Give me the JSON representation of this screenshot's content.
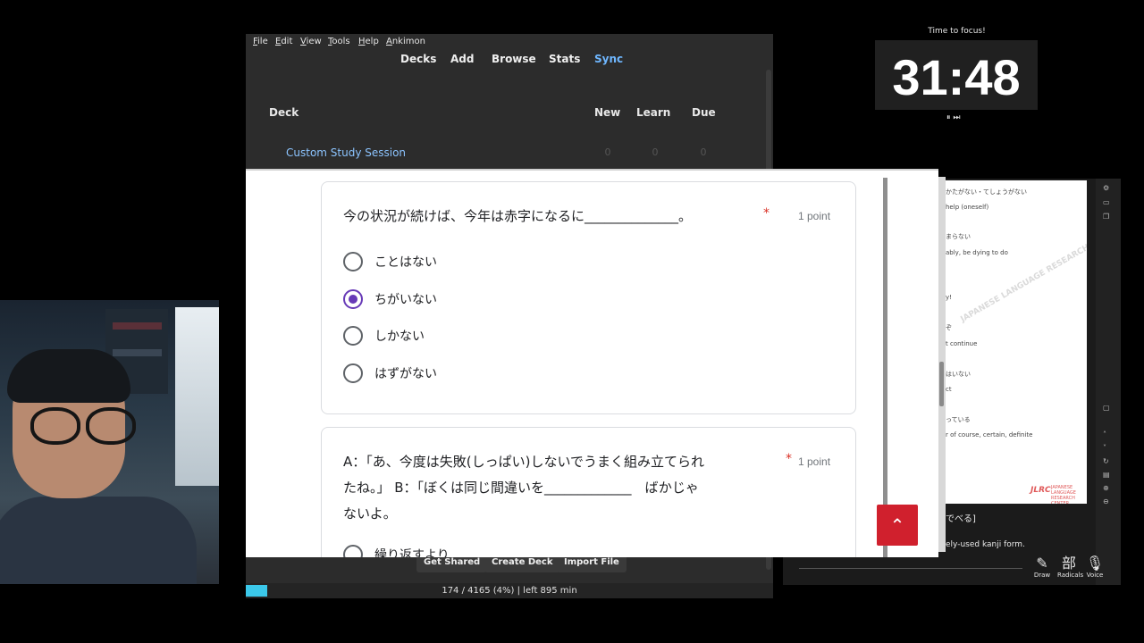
{
  "anki": {
    "menu": [
      {
        "label": "File",
        "u": "F"
      },
      {
        "label": "Edit",
        "u": "E"
      },
      {
        "label": "View",
        "u": "V"
      },
      {
        "label": "Tools",
        "u": "T"
      },
      {
        "label": "Help",
        "u": "H"
      },
      {
        "label": "Ankimon",
        "u": "A"
      }
    ],
    "tabs": [
      "Decks",
      "Add",
      "Browse",
      "Stats",
      "Sync"
    ],
    "columns": {
      "deck": "Deck",
      "new": "New",
      "learn": "Learn",
      "due": "Due"
    },
    "rows": [
      {
        "name": "Custom Study Session",
        "new": "0",
        "learn": "0",
        "due": "0"
      }
    ],
    "bottom_buttons": [
      "Get Shared",
      "Create Deck",
      "Import File"
    ],
    "status": "174 / 4165 (4%) | left 895 min"
  },
  "timer": {
    "label": "Time to focus!",
    "time": "31:48",
    "controls": "⏸ ⏭"
  },
  "dictionary": {
    "lines": [
      "かたがない・てしょうがない",
      "help (oneself)",
      "まらない",
      "ably, be dying to do",
      "y!",
      "ぞ",
      "t continue",
      "はいない",
      "ct",
      "っている",
      "r of course, certain, definite"
    ],
    "watermark": "JAPANESE LANGUAGE RESEARCH CENTER",
    "logo": "JLRC",
    "logo_sub": "JAPANESE LANGUAGE RESEARCH CENTER",
    "bottom_text_1": "でべる]",
    "bottom_text_2": "ely-used kanji form.",
    "tools": [
      {
        "icon": "✎",
        "label": "Draw"
      },
      {
        "icon": "部",
        "label": "Radicals"
      },
      {
        "icon": "🎙",
        "label": "Voice"
      }
    ]
  },
  "form": {
    "accent_color": "#673ab7",
    "required_color": "#d93025",
    "questions": [
      {
        "text": "今の状況が続けば、今年は赤字になるに______________。",
        "required": "*",
        "points": "1 point",
        "options": [
          {
            "label": "ことはない",
            "selected": false
          },
          {
            "label": "ちがいない",
            "selected": true
          },
          {
            "label": "しかない",
            "selected": false
          },
          {
            "label": "はずがない",
            "selected": false
          }
        ]
      },
      {
        "text_line1": "A：「あ、今度は失敗(しっぱい)しないでうまく組み立てられ",
        "text_line2": "たね。」 B：「ぼくは同じ間違いを_____________　ばかじゃ",
        "text_line3": "ないよ。",
        "required": "*",
        "points": "1 point",
        "options": [
          {
            "label": "繰り返すより",
            "selected": false
          }
        ]
      }
    ],
    "scroll_top_icon": "⌃"
  }
}
